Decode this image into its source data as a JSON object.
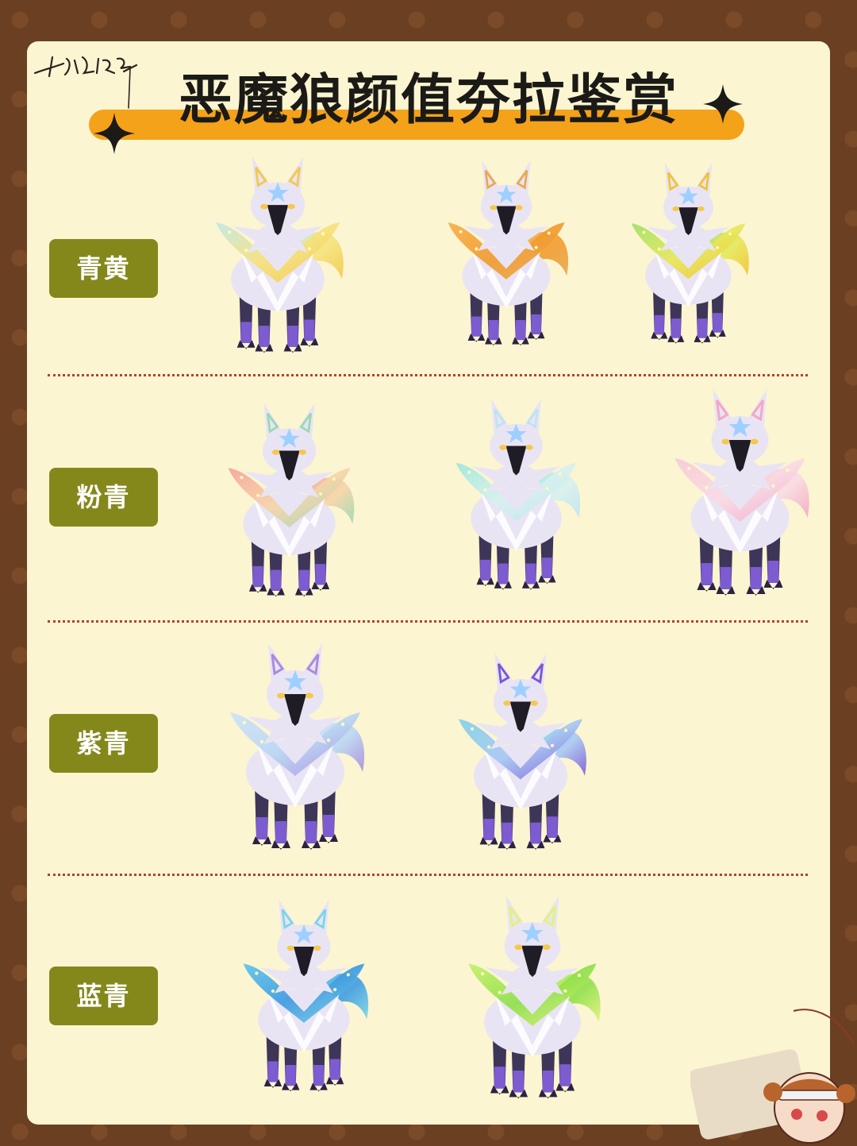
{
  "page": {
    "title": "恶魔狼颜值夯拉鉴赏"
  },
  "rows": [
    {
      "label": "青黄",
      "variants": [
        {
          "icon": "wolf-yellow-cyan",
          "wing_colors": [
            "#bfe8ea",
            "#f7e27a",
            "#f2c94c"
          ]
        },
        {
          "icon": "wolf-orange",
          "wing_colors": [
            "#f6b04a",
            "#f29b2e",
            "#e8a84c"
          ]
        },
        {
          "icon": "wolf-green-yellow",
          "wing_colors": [
            "#9ee06a",
            "#e6e85a",
            "#f3c22b"
          ]
        }
      ]
    },
    {
      "label": "粉青",
      "variants": [
        {
          "icon": "wolf-pink-green",
          "wing_colors": [
            "#f4a39a",
            "#f7d4a8",
            "#9ad9b3"
          ]
        },
        {
          "icon": "wolf-mint",
          "wing_colors": [
            "#9ee7dc",
            "#d8f1ee",
            "#bfe3f0"
          ]
        },
        {
          "icon": "wolf-pink",
          "wing_colors": [
            "#f8c9d8",
            "#f9dbe4",
            "#f3a7c3"
          ]
        }
      ]
    },
    {
      "label": "紫青",
      "variants": [
        {
          "icon": "wolf-lavender-blue",
          "wing_colors": [
            "#cfe3f7",
            "#b9d6f3",
            "#a78be0"
          ]
        },
        {
          "icon": "wolf-cyan-purple",
          "wing_colors": [
            "#7fd1ea",
            "#a7c8f3",
            "#7a56d6"
          ]
        }
      ]
    },
    {
      "label": "蓝青",
      "variants": [
        {
          "icon": "wolf-blue",
          "wing_colors": [
            "#5cc4ee",
            "#3f9be0",
            "#79d6e8"
          ]
        },
        {
          "icon": "wolf-lime",
          "wing_colors": [
            "#c4f06a",
            "#8fe04a",
            "#e2f27a"
          ]
        }
      ]
    }
  ],
  "colors": {
    "border": "#6b3f22",
    "card": "#fbf5d2",
    "title_band": "#f4a21a",
    "label_bg": "#84881a",
    "divider": "#b7402b",
    "fur": "#e9e4f4",
    "legs": "#3e3658",
    "claws": "#7d5bd1"
  },
  "decorations": {
    "signature_icon": "handwritten-signature",
    "mascot_icon": "chibi-girl-mascot"
  }
}
